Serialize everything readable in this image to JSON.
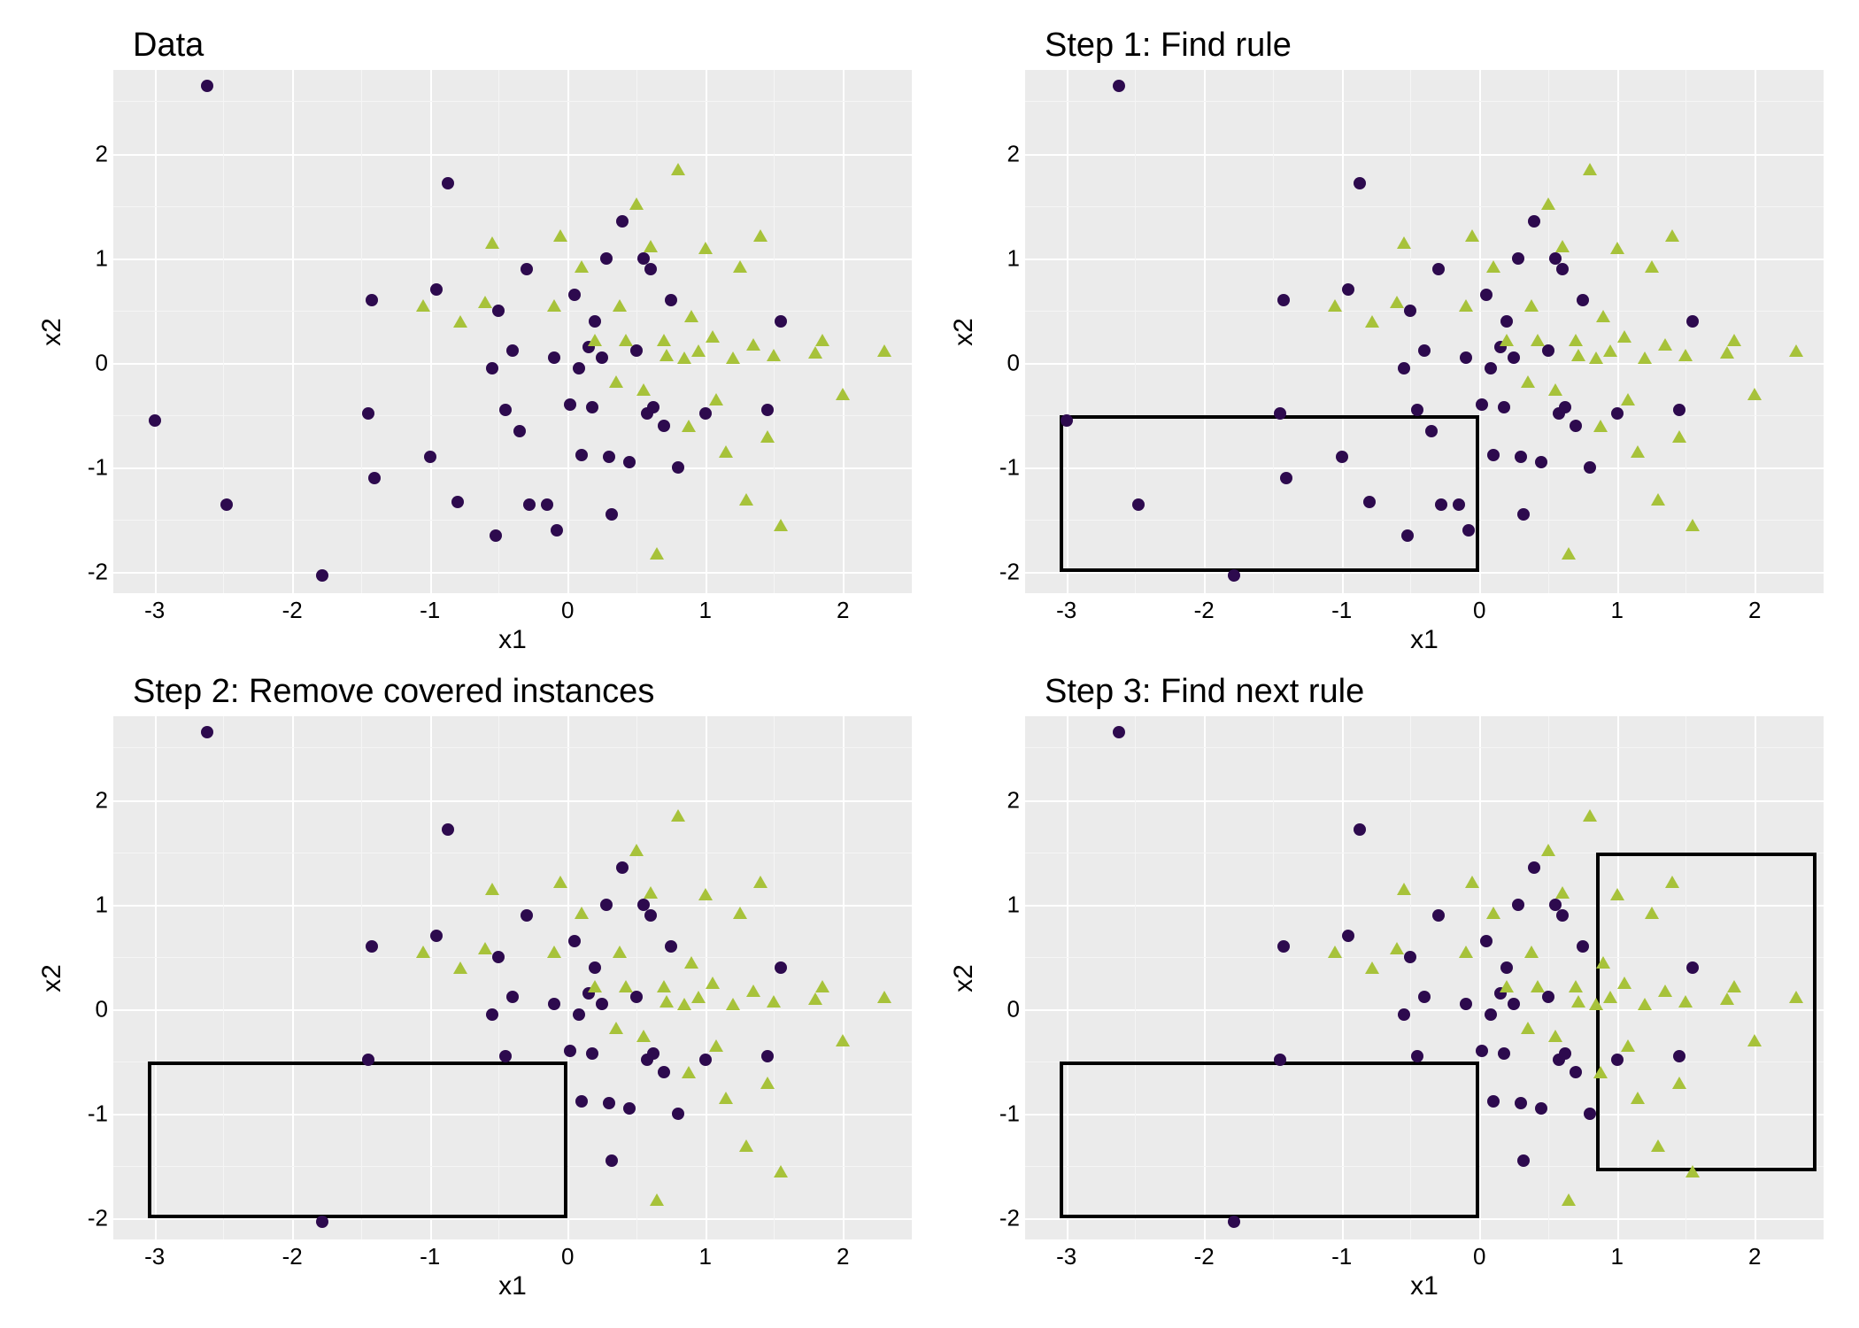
{
  "chart_data": [
    {
      "type": "scatter",
      "title": "Data",
      "xlabel": "x1",
      "ylabel": "x2",
      "xlim": [
        -3.3,
        2.5
      ],
      "ylim": [
        -2.2,
        2.8
      ],
      "xticks": [
        -3,
        -2,
        -1,
        0,
        1,
        2
      ],
      "yticks": [
        -2,
        -1,
        0,
        1,
        2
      ],
      "series": [
        {
          "name": "class-circle",
          "shape": "circle",
          "color": "#2d0a4e",
          "points": [
            [
              -2.62,
              2.65
            ],
            [
              -3.0,
              -0.55
            ],
            [
              -2.48,
              -1.35
            ],
            [
              -1.78,
              -2.03
            ],
            [
              -1.45,
              -0.48
            ],
            [
              -1.42,
              0.6
            ],
            [
              -1.4,
              -1.1
            ],
            [
              -1.0,
              -0.9
            ],
            [
              -0.95,
              0.7
            ],
            [
              -0.87,
              1.72
            ],
            [
              -0.8,
              -1.33
            ],
            [
              -0.55,
              -0.05
            ],
            [
              -0.52,
              -1.65
            ],
            [
              -0.5,
              0.5
            ],
            [
              -0.45,
              -0.45
            ],
            [
              -0.4,
              0.12
            ],
            [
              -0.35,
              -0.65
            ],
            [
              -0.3,
              0.9
            ],
            [
              -0.28,
              -1.35
            ],
            [
              -0.15,
              -1.35
            ],
            [
              -0.1,
              0.05
            ],
            [
              -0.08,
              -1.6
            ],
            [
              0.02,
              -0.4
            ],
            [
              0.05,
              0.65
            ],
            [
              0.08,
              -0.05
            ],
            [
              0.1,
              -0.88
            ],
            [
              0.15,
              0.15
            ],
            [
              0.18,
              -0.42
            ],
            [
              0.2,
              0.4
            ],
            [
              0.25,
              0.05
            ],
            [
              0.28,
              1.0
            ],
            [
              0.3,
              -0.9
            ],
            [
              0.32,
              -1.45
            ],
            [
              0.4,
              1.35
            ],
            [
              0.45,
              -0.95
            ],
            [
              0.5,
              0.12
            ],
            [
              0.55,
              1.0
            ],
            [
              0.58,
              -0.48
            ],
            [
              0.6,
              0.9
            ],
            [
              0.62,
              -0.42
            ],
            [
              0.7,
              -0.6
            ],
            [
              0.75,
              0.6
            ],
            [
              0.8,
              -1.0
            ],
            [
              1.0,
              -0.48
            ],
            [
              1.45,
              -0.45
            ],
            [
              1.55,
              0.4
            ]
          ]
        },
        {
          "name": "class-triangle",
          "shape": "triangle",
          "color": "#a7c23a",
          "points": [
            [
              -1.05,
              0.55
            ],
            [
              -0.78,
              0.4
            ],
            [
              -0.6,
              0.58
            ],
            [
              -0.55,
              1.15
            ],
            [
              -0.1,
              0.55
            ],
            [
              -0.05,
              1.22
            ],
            [
              0.1,
              0.92
            ],
            [
              0.2,
              0.22
            ],
            [
              0.35,
              -0.18
            ],
            [
              0.38,
              0.55
            ],
            [
              0.42,
              0.22
            ],
            [
              0.5,
              1.52
            ],
            [
              0.55,
              -0.25
            ],
            [
              0.6,
              1.12
            ],
            [
              0.65,
              -1.82
            ],
            [
              0.7,
              0.22
            ],
            [
              0.72,
              0.08
            ],
            [
              0.8,
              1.85
            ],
            [
              0.85,
              0.05
            ],
            [
              0.88,
              -0.6
            ],
            [
              0.9,
              0.45
            ],
            [
              0.95,
              0.12
            ],
            [
              1.0,
              1.1
            ],
            [
              1.05,
              0.25
            ],
            [
              1.08,
              -0.35
            ],
            [
              1.15,
              -0.85
            ],
            [
              1.2,
              0.05
            ],
            [
              1.25,
              0.92
            ],
            [
              1.3,
              -1.3
            ],
            [
              1.35,
              0.18
            ],
            [
              1.4,
              1.22
            ],
            [
              1.45,
              -0.7
            ],
            [
              1.5,
              0.08
            ],
            [
              1.55,
              -1.55
            ],
            [
              1.8,
              0.1
            ],
            [
              1.85,
              0.22
            ],
            [
              2.0,
              -0.3
            ],
            [
              2.3,
              0.12
            ]
          ]
        }
      ],
      "rules": []
    },
    {
      "type": "scatter",
      "title": "Step 1: Find rule",
      "xlabel": "x1",
      "ylabel": "x2",
      "xlim": [
        -3.3,
        2.5
      ],
      "ylim": [
        -2.2,
        2.8
      ],
      "xticks": [
        -3,
        -2,
        -1,
        0,
        1,
        2
      ],
      "yticks": [
        -2,
        -1,
        0,
        1,
        2
      ],
      "series": "same-as-0",
      "rules": [
        {
          "x": [
            -3.05,
            0.0
          ],
          "y": [
            -2.0,
            -0.5
          ]
        }
      ]
    },
    {
      "type": "scatter",
      "title": "Step 2: Remove covered instances",
      "xlabel": "x1",
      "ylabel": "x2",
      "xlim": [
        -3.3,
        2.5
      ],
      "ylim": [
        -2.2,
        2.8
      ],
      "xticks": [
        -3,
        -2,
        -1,
        0,
        1,
        2
      ],
      "yticks": [
        -2,
        -1,
        0,
        1,
        2
      ],
      "series": "same-as-0-minus-rule1",
      "rules": [
        {
          "x": [
            -3.05,
            0.0
          ],
          "y": [
            -2.0,
            -0.5
          ]
        }
      ]
    },
    {
      "type": "scatter",
      "title": "Step 3: Find next rule",
      "xlabel": "x1",
      "ylabel": "x2",
      "xlim": [
        -3.3,
        2.5
      ],
      "ylim": [
        -2.2,
        2.8
      ],
      "xticks": [
        -3,
        -2,
        -1,
        0,
        1,
        2
      ],
      "yticks": [
        -2,
        -1,
        0,
        1,
        2
      ],
      "series": "same-as-0-minus-rule1",
      "rules": [
        {
          "x": [
            -3.05,
            0.0
          ],
          "y": [
            -2.0,
            -0.5
          ]
        },
        {
          "x": [
            0.85,
            2.45
          ],
          "y": [
            -1.55,
            1.5
          ]
        }
      ]
    }
  ],
  "colors": {
    "circle": "#2d0a4e",
    "triangle": "#a7c23a",
    "panel_bg": "#ebebeb",
    "grid": "#ffffff"
  }
}
